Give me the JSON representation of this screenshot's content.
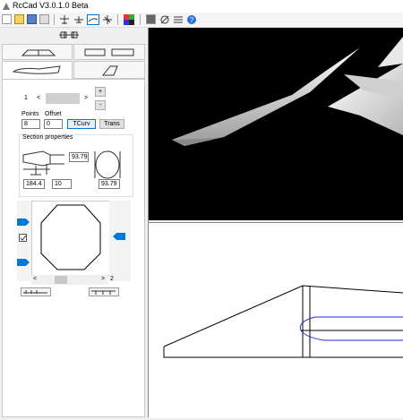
{
  "window": {
    "title": "RcCad V3.0.1.0 Beta"
  },
  "toolbar": {
    "icons": [
      "new-icon",
      "open-icon",
      "save-icon",
      "print-icon",
      "plane-icon",
      "wing-icon",
      "curve-icon",
      "tail-icon",
      "rgb-icon",
      "grid-icon",
      "view-icon",
      "settings-icon",
      "help-icon"
    ],
    "rgb_label": "RGB"
  },
  "section": {
    "index": "1",
    "prev_label": "<",
    "next_label": ">",
    "plus_label": "+",
    "minus_label": "-",
    "points_label": "Points",
    "offset_label": "Offset",
    "points_value": "8",
    "offset_value": "0",
    "tcurv_label": "TCurv",
    "trans_label": "Trans",
    "properties_label": "Section properties",
    "height_value": "93.79",
    "length_value": "184.4",
    "position_value": "10",
    "width_value": "93.79"
  },
  "scroll": {
    "left_label": "<",
    "right_label": ">",
    "value": "2"
  },
  "accent": "#0078d7"
}
